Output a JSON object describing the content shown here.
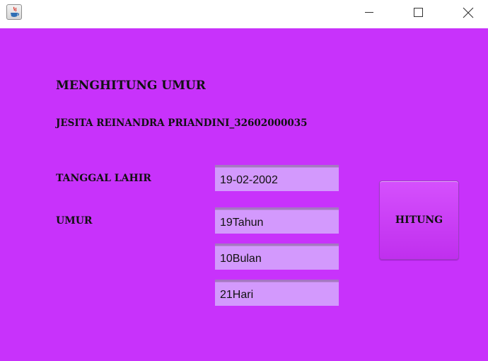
{
  "window": {
    "app_icon": "java-cup-icon",
    "controls": [
      "minimize-icon",
      "maximize-icon",
      "close-icon"
    ]
  },
  "form": {
    "title": "MENGHITUNG UMUR",
    "student": "JESITA REINANDRA PRIANDINI_32602000035",
    "birthdate_label": "TANGGAL LAHIR",
    "birthdate_value": "19-02-2002",
    "age_label": "UMUR",
    "years_value": "19Tahun",
    "months_value": "10Bulan",
    "days_value": "21Hari",
    "calculate_button": "HITUNG"
  },
  "colors": {
    "background": "#c832fb",
    "field_background": "#d399fd",
    "button_background": "#cc42f6"
  }
}
